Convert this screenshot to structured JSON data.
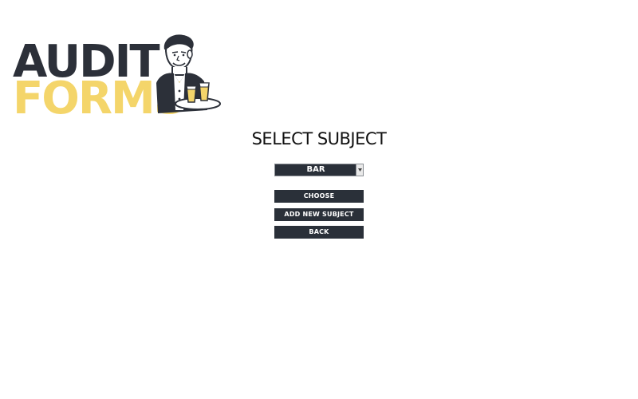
{
  "logo": {
    "line1": "AUDIT",
    "line2": "FORMS",
    "line1_color": "#2c3039",
    "line2_color": "#f4d56a",
    "mascot_icon": "waiter-with-beer-tray-icon"
  },
  "page": {
    "title": "SELECT SUBJECT"
  },
  "subject_select": {
    "selected": "BAR",
    "arrow_icon": "chevron-down-icon"
  },
  "actions": {
    "choose_label": "CHOOSE",
    "add_label": "ADD NEW SUBJECT",
    "back_label": "BACK"
  },
  "colors": {
    "button_bg": "#2a3039",
    "button_text": "#ffffff",
    "background": "#ffffff"
  }
}
